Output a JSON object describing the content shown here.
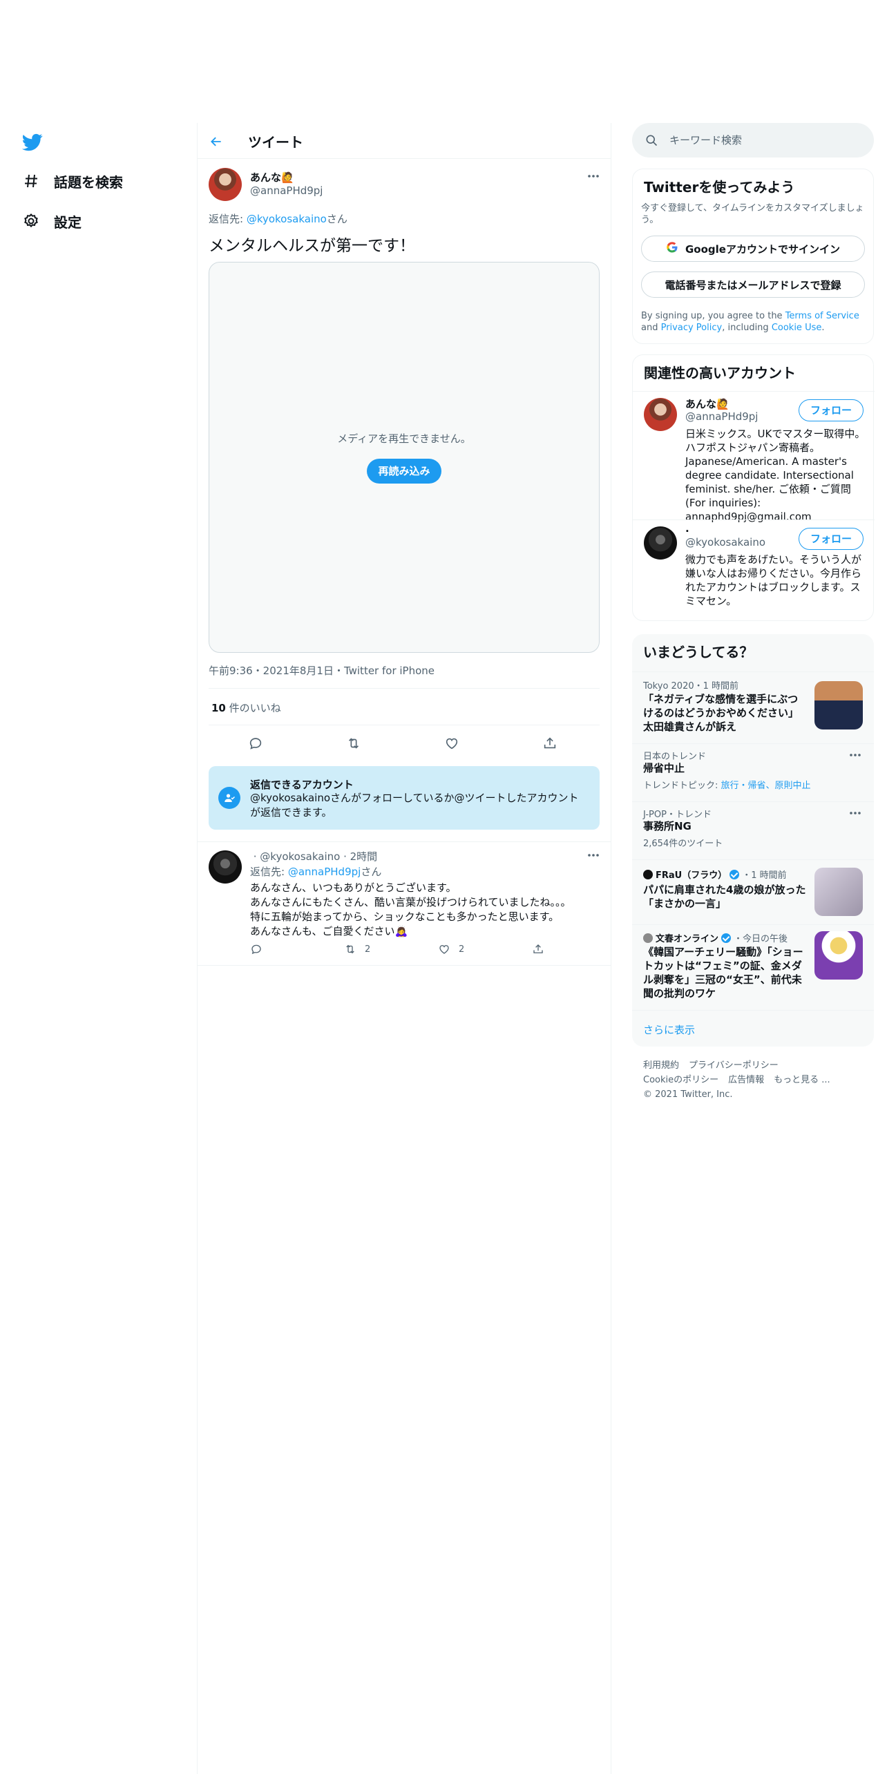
{
  "nav": {
    "logo": "twitter-bird-icon",
    "items": [
      {
        "label": "話題を検索",
        "icon": "hashtag-icon"
      },
      {
        "label": "設定",
        "icon": "gear-icon"
      }
    ]
  },
  "header": {
    "title": "ツイート"
  },
  "tweet": {
    "name": "あんな🙋",
    "handle": "@annaPHd9pj",
    "reply_prefix": "返信先: ",
    "reply_handle": "@kyokosakaino",
    "reply_suffix": "さん",
    "text": "メンタルヘルスが第一です！",
    "media_message": "メディアを再生できません。",
    "reload_label": "再読み込み",
    "meta": "午前9:36・2021年8月1日・Twitter for iPhone",
    "likes_count": "10",
    "likes_label": " 件のいいね"
  },
  "reply_info": {
    "title": "返信できるアカウント",
    "body": "@kyokosakainoさんがフォローしているか@ツイートしたアカウントが返信できます。"
  },
  "reply": {
    "head": "​ · @kyokosakaino · 2時間",
    "sub_prefix": "返信先: ",
    "sub_handle": "@annaPHd9pj",
    "sub_suffix": "さん",
    "lines": [
      "あんなさん、いつもありがとうございます。",
      "あんなさんにもたくさん、酷い言葉が投げつけられていましたね。。。",
      "特に五輪が始まってから、ショックなことも多かったと思います。",
      "あんなさんも、ご自愛ください🙇‍♀️"
    ],
    "retweets": "2",
    "likes": "2"
  },
  "search": {
    "placeholder": "キーワード検索"
  },
  "signup": {
    "title": "Twitterを使ってみよう",
    "subtitle": "今すぐ登録して、タイムラインをカスタマイズしましょう。",
    "google_label": "Googleアカウントでサインイン",
    "phone_label": "電話番号またはメールアドレスで登録",
    "legal_a": "By signing up, you agree to the ",
    "legal_tos": "Terms of Service",
    "legal_b": " and ",
    "legal_privacy": "Privacy Policy",
    "legal_c": ", including ",
    "legal_cookie": "Cookie Use",
    "legal_d": "."
  },
  "related": {
    "title": "関連性の高いアカウント",
    "follow_label": "フォロー",
    "accounts": [
      {
        "name": "あんな🙋",
        "handle": "@annaPHd9pj",
        "bio": "日米ミックス。UKでマスター取得中。ハフポストジャパン寄稿者。Japanese/American. A master's degree candidate. Intersectional feminist. she/her. ご依頼・ご質問 (For inquiries): annaphd9pj@gmail.com"
      },
      {
        "name": ".",
        "handle": "@kyokosakaino",
        "bio": "微力でも声をあげたい。そういう人が嫌いな人はお帰りください。今月作られたアカウントはブロックします。スミマセン。"
      }
    ]
  },
  "trends": {
    "title": "いまどうしてる？",
    "items": [
      {
        "meta": "Tokyo 2020・1 時間前",
        "title": "「ネガティブな感情を選手にぶつけるのはどうかおやめください」 太田雄貴さんが訴え"
      },
      {
        "meta": "日本のトレンド",
        "title": "帰省中止",
        "sub_prefix": "トレンドトピック: ",
        "sub_links": "旅行・帰省、原則中止"
      },
      {
        "meta": "J-POP・トレンド",
        "title": "事務所NG",
        "sub": "2,654件のツイート"
      },
      {
        "source": "FRaU（フラウ）",
        "time": "・1 時間前",
        "title": "パパに肩車された4歳の娘が放った「まさかの一言」"
      },
      {
        "source": "文春オンライン",
        "time": "・今日の午後",
        "title": "《韓国アーチェリー騒動》「ショートカットは“フェミ”の証、金メダル剥奪を」三冠の“女王”、前代未聞の批判のワケ"
      }
    ],
    "show_more": "さらに表示"
  },
  "footer": {
    "links": [
      "利用規約",
      "プライバシーポリシー",
      "Cookieのポリシー",
      "広告情報",
      "もっと見る ..."
    ],
    "copyright": "© 2021 Twitter, Inc."
  }
}
